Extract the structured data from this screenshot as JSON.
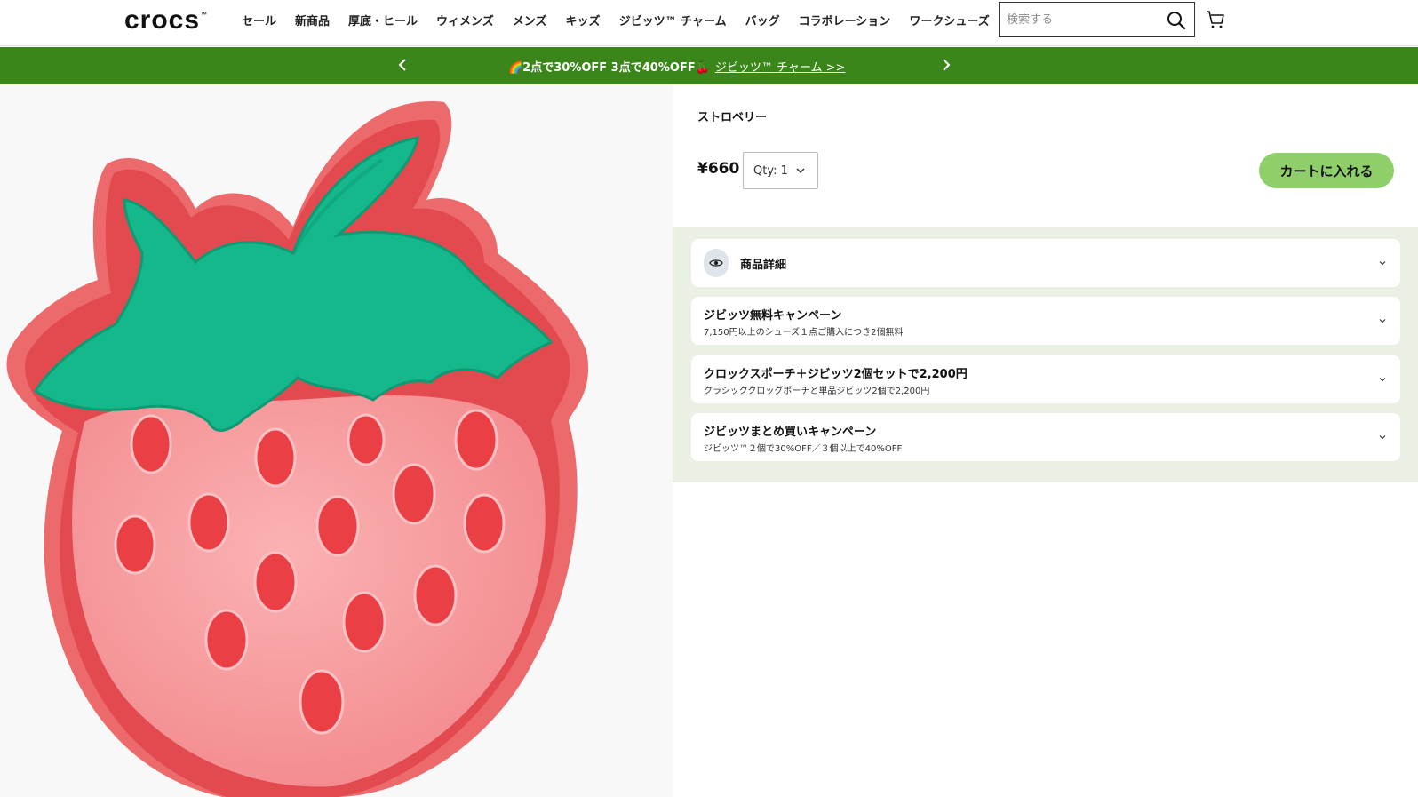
{
  "header": {
    "logo": "crocs",
    "logo_tm": "™",
    "nav": [
      "セール",
      "新商品",
      "厚底・ヒール",
      "ウィメンズ",
      "メンズ",
      "キッズ",
      "ジビッツ™ チャーム",
      "バッグ",
      "コラボレーション",
      "ワークシューズ"
    ],
    "search_placeholder": "検索する",
    "search_icon": "search-icon",
    "cart_icon": "cart-icon"
  },
  "promo": {
    "text": "🌈2点で30%OFF 3点で40%OFF🍒",
    "link": "ジビッツ™ チャーム >>"
  },
  "product": {
    "title": "ストロベリー",
    "price": "¥660",
    "qty_label": "Qty: 1",
    "add_to_cart": "カートに入れる"
  },
  "accordions": [
    {
      "title": "商品詳細",
      "subtitle": "",
      "icon": "eye-icon"
    },
    {
      "title": "ジビッツ無料キャンペーン",
      "subtitle": "7,150円以上のシューズ１点ご購入につき2個無料"
    },
    {
      "title": "クロックスポーチ＋ジビッツ2個セットで2,200円",
      "subtitle": "クラシッククロッグポーチと単品ジビッツ2個で2,200円"
    },
    {
      "title": "ジビッツまとめ買いキャンペーン",
      "subtitle": "ジビッツ™２個で30%OFF／３個以上で40%OFF"
    }
  ],
  "colors": {
    "promo_green": "#3a861b",
    "cart_button": "#8fcf6a",
    "details_bg": "#eaf1e4",
    "strawberry_red": "#e9545a",
    "strawberry_pink": "#f48a8e",
    "leaf_green": "#14b88a"
  }
}
